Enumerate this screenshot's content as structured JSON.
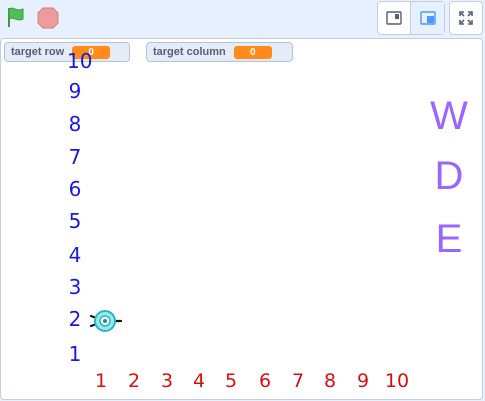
{
  "monitors": [
    {
      "label": "target row",
      "value": "0"
    },
    {
      "label": "target column",
      "value": "0"
    }
  ],
  "row_labels": [
    "10",
    "9",
    "8",
    "7",
    "6",
    "5",
    "4",
    "3",
    "2",
    "1"
  ],
  "column_labels": [
    "1",
    "2",
    "3",
    "4",
    "5",
    "6",
    "7",
    "8",
    "9",
    "10"
  ],
  "letters": [
    "W",
    "D",
    "E"
  ],
  "colors": {
    "row_labels": "#1a1ad9",
    "column_labels": "#d90f0f",
    "letters": "#9966ff",
    "monitor_value": "#ff8c1a"
  },
  "icons": {
    "green_flag": "green-flag-icon",
    "stop": "stop-icon",
    "small_stage": "small-stage-icon",
    "large_stage": "large-stage-icon",
    "fullscreen": "fullscreen-icon",
    "sprite": "robot-sprite"
  }
}
